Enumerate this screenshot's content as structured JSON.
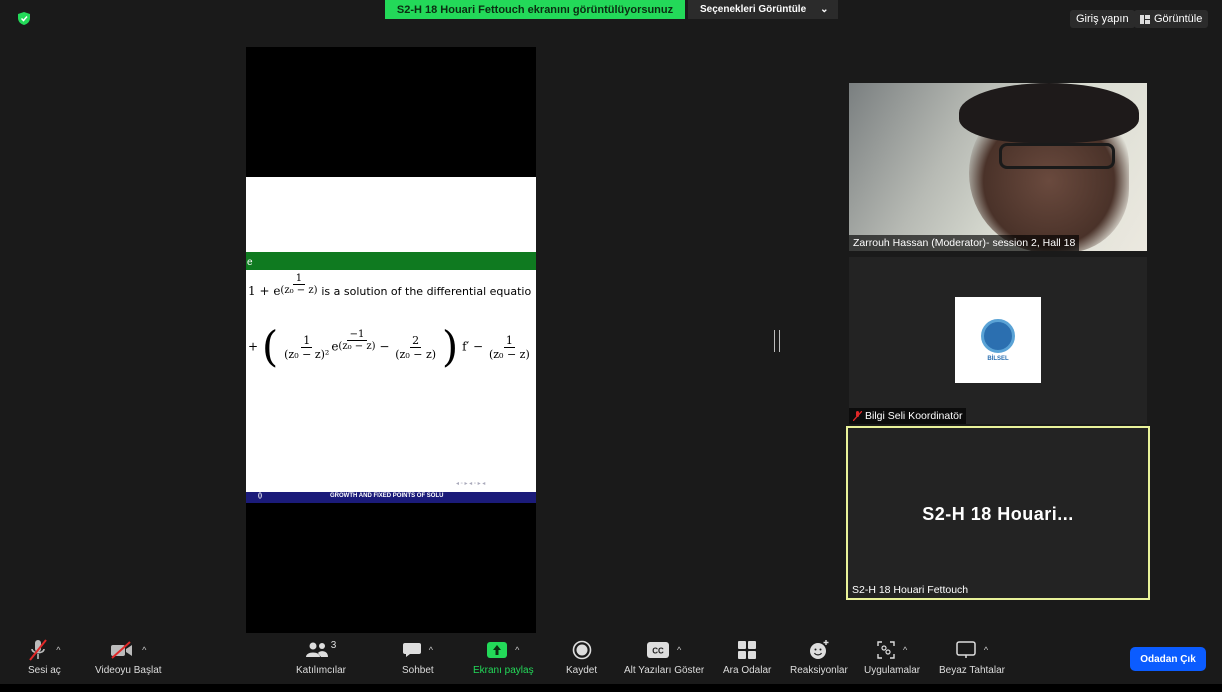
{
  "top_bar": {
    "share_banner": "S2-H 18  Houari Fettouch ekranını görüntülüyorsunuz",
    "options_label": "Seçenekleri Görüntüle",
    "sign_in": "Giriş yapın",
    "view_label": "Görüntüle"
  },
  "shared_slide": {
    "header_fragment": "e",
    "formula1_prefix": "1 + e",
    "formula1_exp_num": "1",
    "formula1_exp_den": "(z₀ − z)",
    "formula1_suffix": "is a solution of the differential equatio",
    "formula2_plus": "+",
    "formula2_f1_num": "1",
    "formula2_f1_den": "(z₀ − z)²",
    "formula2_e": "e",
    "formula2_exp_num": "−1",
    "formula2_exp_den": "(z₀ − z)",
    "formula2_minus": "−",
    "formula2_f2_num": "2",
    "formula2_f2_den": "(z₀ − z)",
    "formula2_fprime": "f′ −",
    "formula2_f3_num": "1",
    "formula2_f3_den": "(z₀ − z)",
    "footer_left": "()",
    "footer_title": "GROWTH AND FIXED POINTS OF SOLU",
    "nav_dots": "◂ ▫ ▸ ◂ ▫ ▸ ◂"
  },
  "participants": [
    {
      "name": "Zarrouh Hassan (Moderator)- session 2, Hall 18",
      "type": "video"
    },
    {
      "name": "Bilgi Seli Koordinatör",
      "type": "logo",
      "muted": true,
      "logo_text": "BİLSEL"
    },
    {
      "name": "S2-H 18  Houari Fettouch",
      "display_title": "S2-H 18  Houari...",
      "type": "name",
      "active_speaker": true
    }
  ],
  "toolbar": {
    "mute": "Sesi aç",
    "video": "Videoyu Başlat",
    "participants": "Katılımcılar",
    "participants_count": "3",
    "chat": "Sohbet",
    "share": "Ekranı paylaş",
    "record": "Kaydet",
    "captions": "Alt Yazıları Göster",
    "breakout": "Ara Odalar",
    "reactions": "Reaksiyonlar",
    "apps": "Uygulamalar",
    "whiteboard": "Beyaz Tahtalar",
    "leave": "Odadan Çık"
  },
  "colors": {
    "banner_green": "#23d959",
    "slide_green": "#0f7a20",
    "active_border": "#e9f29a",
    "leave_blue": "#0b5cff",
    "mute_red": "#e02828"
  }
}
